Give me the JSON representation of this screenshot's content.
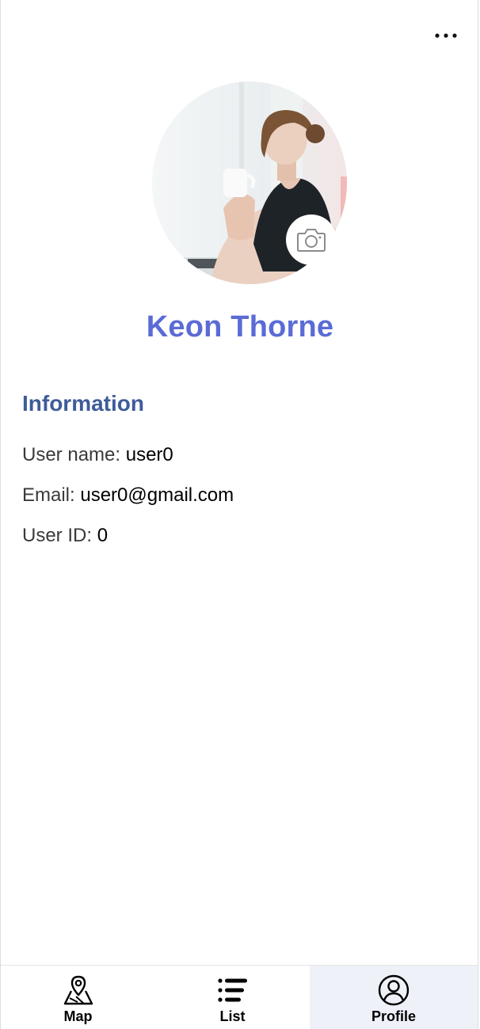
{
  "profile": {
    "full_name": "Keon Thorne",
    "avatar_alt": "profile photo"
  },
  "info": {
    "title": "Information",
    "rows": [
      {
        "label": "User name:",
        "value": "user0"
      },
      {
        "label": "Email:",
        "value": "user0@gmail.com"
      },
      {
        "label": "User ID:",
        "value": "0"
      }
    ]
  },
  "nav": {
    "items": [
      {
        "label": "Map",
        "icon": "map-pin-icon"
      },
      {
        "label": "List",
        "icon": "list-icon"
      },
      {
        "label": "Profile",
        "icon": "user-circle-icon",
        "active": true
      }
    ]
  },
  "colors": {
    "name": "#5b6bd6",
    "section_title": "#3e5c9a",
    "active_tab_bg": "#eef1f7"
  }
}
